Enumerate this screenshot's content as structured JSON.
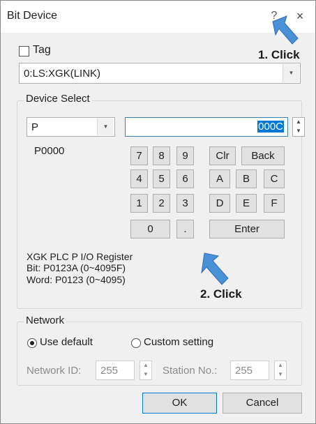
{
  "window": {
    "title": "Bit Device",
    "help": "?",
    "close": "×"
  },
  "tag": {
    "label": "Tag",
    "checked": false
  },
  "plc": {
    "value": "0:LS:XGK(LINK)"
  },
  "device_select": {
    "title": "Device Select",
    "device_type": "P",
    "device_name": "P0000",
    "address_value": "000C",
    "keypad": {
      "digits": [
        "7",
        "8",
        "9",
        "4",
        "5",
        "6",
        "1",
        "2",
        "3"
      ],
      "zero": "0",
      "dot": ".",
      "clr": "Clr",
      "back": "Back",
      "hex": [
        "A",
        "B",
        "C",
        "D",
        "E",
        "F"
      ],
      "enter": "Enter"
    },
    "info": {
      "line1": "XGK PLC P I/O Register",
      "line2": "Bit: P0123A (0~4095F)",
      "line3": "Word: P0123 (0~4095)"
    }
  },
  "network": {
    "title": "Network",
    "use_default": "Use default",
    "custom_setting": "Custom setting",
    "selected": "use_default",
    "network_id_label": "Network ID:",
    "network_id": "255",
    "station_label": "Station No.:",
    "station_no": "255"
  },
  "buttons": {
    "ok": "OK",
    "cancel": "Cancel"
  },
  "annotations": {
    "step1": "1. Click",
    "step2": "2. Click",
    "arrow_color": "#4a90d9"
  },
  "icons": [
    "help-icon",
    "close-icon",
    "dropdown-arrow-icon",
    "spin-up-icon",
    "spin-down-icon",
    "annotation-arrow-icon"
  ]
}
